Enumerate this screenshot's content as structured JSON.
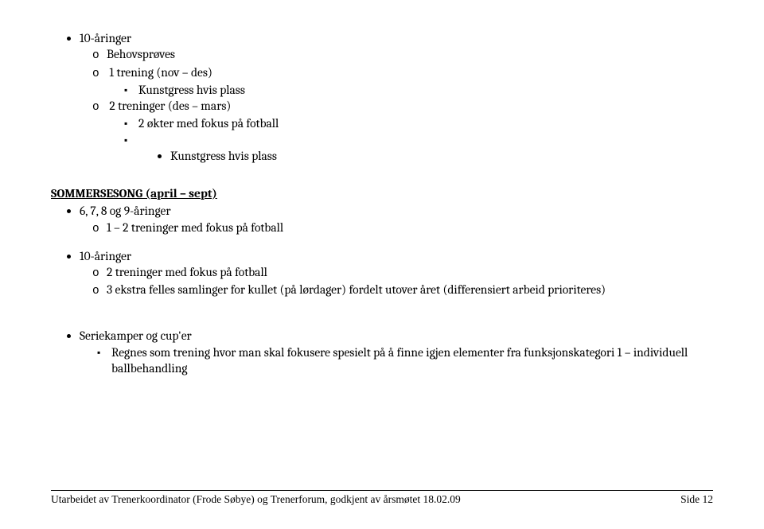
{
  "group1": {
    "heading": "10-åringer",
    "items": [
      {
        "text": "Behovsprøves"
      },
      {
        "text": "1 trening (nov – des)",
        "sub": [
          "Kunstgress hvis plass"
        ]
      },
      {
        "text": "2 treninger (des – mars)",
        "sub": [
          "2 økter med fokus på fotball",
          "Kunstgress hvis plass"
        ]
      }
    ]
  },
  "summerSeason": {
    "heading": "SOMMERSESONG (april – sept)",
    "group1": {
      "heading": "6, 7, 8 og 9-åringer",
      "items": [
        {
          "text": "1 – 2 treninger med fokus på fotball"
        }
      ]
    },
    "group2": {
      "heading": "10-åringer",
      "items": [
        {
          "text": "2 treninger med fokus på fotball"
        },
        {
          "text": "3 ekstra felles samlinger for kullet (på lørdager) fordelt utover året (differensiert arbeid prioriteres)"
        }
      ]
    }
  },
  "series": {
    "heading": "Seriekamper og cup'er",
    "items": [
      "Regnes som trening hvor man skal fokusere spesielt på å finne igjen elementer fra funksjonskategori 1 – individuell ballbehandling"
    ]
  },
  "footer": {
    "left": "Utarbeidet av Trenerkoordinator (Frode Søbye) og Trenerforum, godkjent av årsmøtet 18.02.09",
    "right": "Side 12"
  }
}
